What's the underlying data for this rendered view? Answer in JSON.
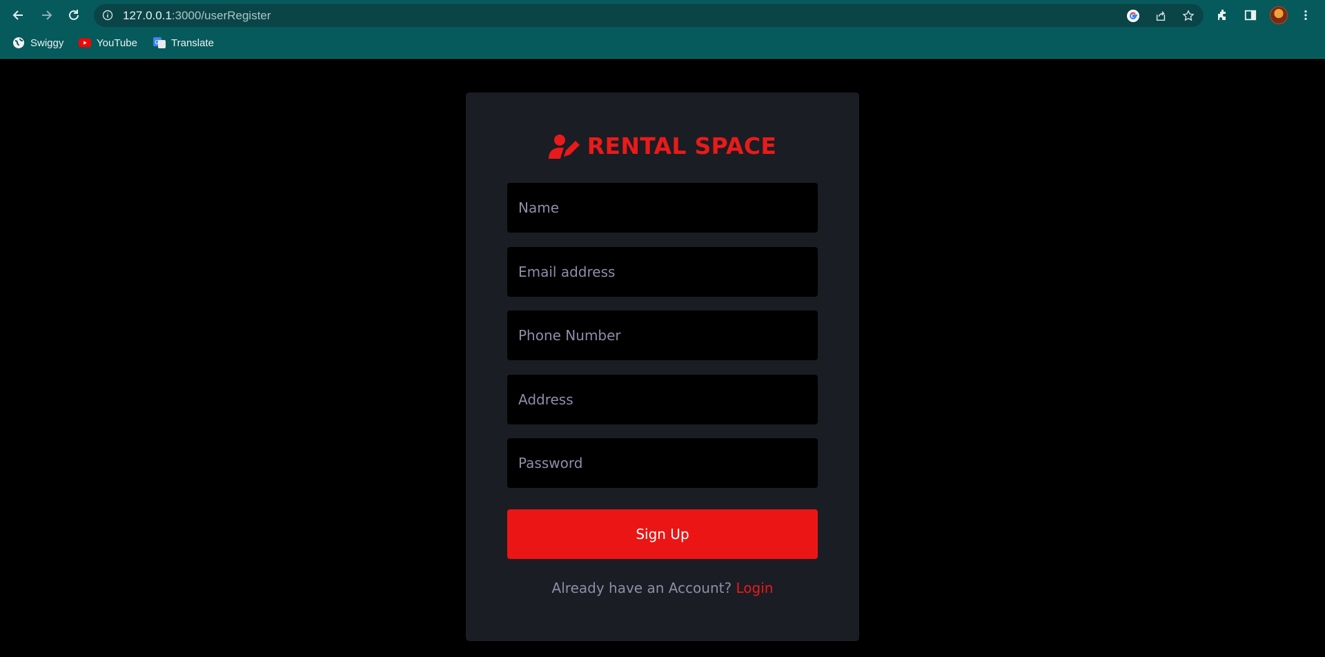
{
  "browser": {
    "url_host": "127.0.0.1",
    "url_path": ":3000/userRegister",
    "bookmarks": [
      {
        "label": "Swiggy",
        "icon": "globe-icon"
      },
      {
        "label": "YouTube",
        "icon": "youtube-icon"
      },
      {
        "label": "Translate",
        "icon": "translate-icon"
      }
    ]
  },
  "page": {
    "brand": "RENTAL SPACE",
    "brand_icon": "user-edit-icon",
    "brand_color": "#ea1a1a",
    "fields": [
      {
        "placeholder": "Name"
      },
      {
        "placeholder": "Email address"
      },
      {
        "placeholder": "Phone Number"
      },
      {
        "placeholder": "Address"
      },
      {
        "placeholder": "Password"
      }
    ],
    "signup_label": "Sign Up",
    "signup_color": "#eb1515",
    "footer_text": "Already have an Account?",
    "login_label": "Login"
  }
}
